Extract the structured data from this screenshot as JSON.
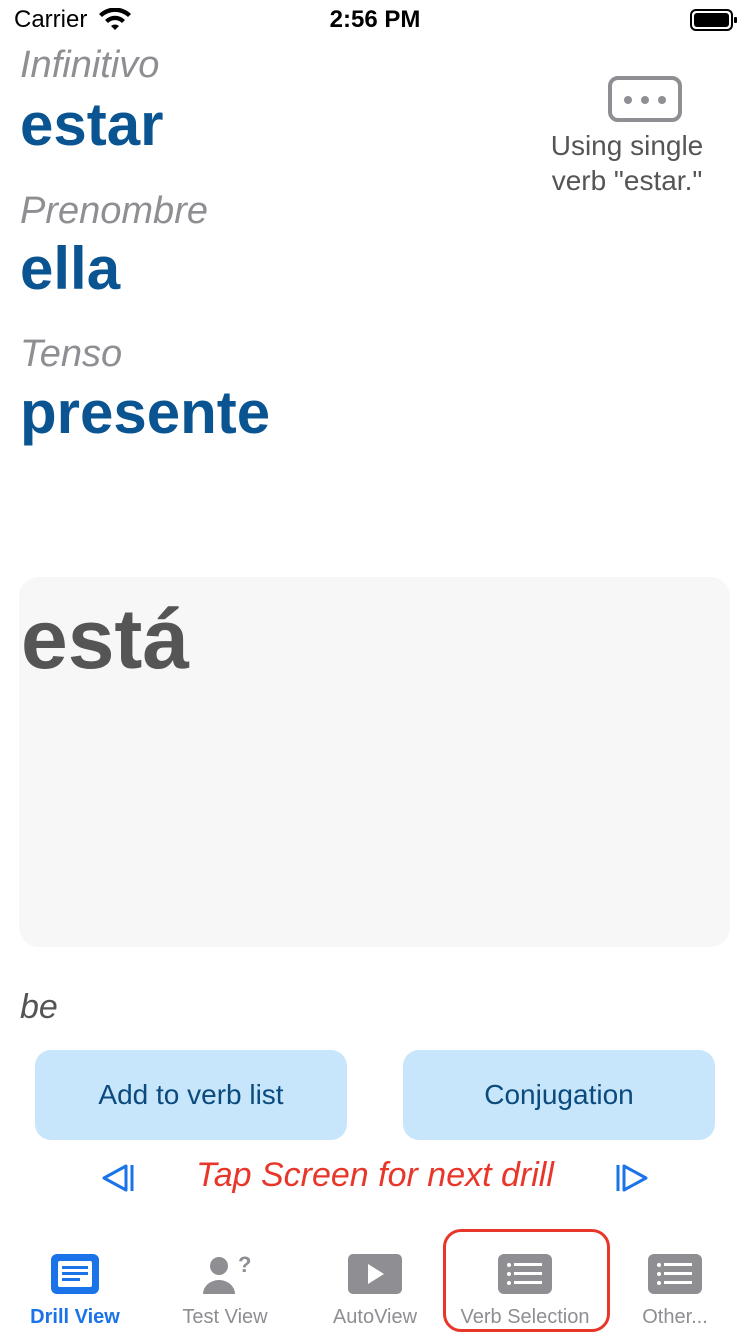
{
  "status_bar": {
    "carrier": "Carrier",
    "time": "2:56 PM"
  },
  "drill": {
    "infinitive": {
      "label": "Infinitivo",
      "value": "estar"
    },
    "pronoun": {
      "label": "Prenombre",
      "value": "ella"
    },
    "tense": {
      "label": "Tenso",
      "value": "presente"
    },
    "single_verb_note": "Using single verb \"estar.\"",
    "answer": "está",
    "translation": "be"
  },
  "actions": {
    "add_to_list": "Add to verb list",
    "conjugation": "Conjugation"
  },
  "navigation": {
    "hint": "Tap Screen for next drill"
  },
  "tabs": [
    {
      "label": "Drill View",
      "icon": "list-icon",
      "active": true
    },
    {
      "label": "Test View",
      "icon": "person-question-icon",
      "active": false
    },
    {
      "label": "AutoView",
      "icon": "play-icon",
      "active": false
    },
    {
      "label": "Verb Selection",
      "icon": "list-icon",
      "active": false
    },
    {
      "label": "Other...",
      "icon": "list-icon",
      "active": false
    }
  ],
  "colors": {
    "accent": "#0a5591",
    "active_tab": "#1a73e8",
    "hint": "#e8372a",
    "button_bg": "#c7e6fb"
  }
}
